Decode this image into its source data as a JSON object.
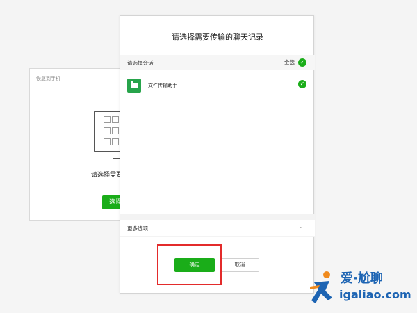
{
  "background_panel": {
    "title": "恢复到手机",
    "hint": "请选择需要",
    "select_button": "选择"
  },
  "dialog": {
    "title": "请选择需要传输的聊天记录",
    "list_header": "请选择会话",
    "select_all": "全选",
    "chat_items": [
      {
        "name": "文件传输助手",
        "checked": true
      }
    ],
    "more_options": "更多选项",
    "ok_button": "确定",
    "cancel_button": "取消"
  },
  "watermark": {
    "line1": "爱·尬聊",
    "line2": "igaliao.com"
  },
  "colors": {
    "accent_green": "#1aad19",
    "highlight_red": "#e32b2b",
    "watermark_blue": "#1d64b3",
    "watermark_orange": "#f08a1d"
  }
}
